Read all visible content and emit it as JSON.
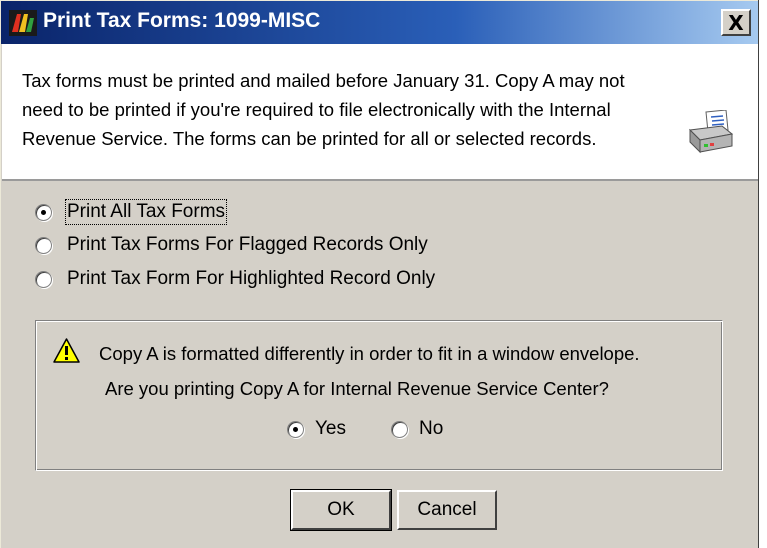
{
  "window": {
    "title": "Print Tax Forms: 1099-MISC",
    "close_label": "X"
  },
  "info": {
    "message": "Tax forms must be printed and mailed before January 31. Copy A may not need to be printed if you're required to file electronically with the Internal Revenue Service. The forms can be printed for all or selected records.",
    "icon": "printer-icon"
  },
  "print_options": [
    {
      "label": "Print All Tax Forms",
      "selected": true
    },
    {
      "label": "Print Tax Forms For Flagged Records Only",
      "selected": false
    },
    {
      "label": "Print Tax Form For Highlighted Record Only",
      "selected": false
    }
  ],
  "copy_a": {
    "icon": "warning-icon",
    "line1": "Copy A is formatted differently in order to fit in a window envelope.",
    "line2": "Are you printing Copy A for Internal Revenue Service Center?",
    "yes_label": "Yes",
    "no_label": "No",
    "selected": "Yes"
  },
  "buttons": {
    "ok_label": "OK",
    "cancel_label": "Cancel"
  },
  "colors": {
    "title_bar_start": "#0a246a",
    "title_bar_end": "#a6caf0",
    "dialog_face": "#d4d0c8",
    "info_background": "#ffffff",
    "warning_yellow": "#ffff00"
  }
}
